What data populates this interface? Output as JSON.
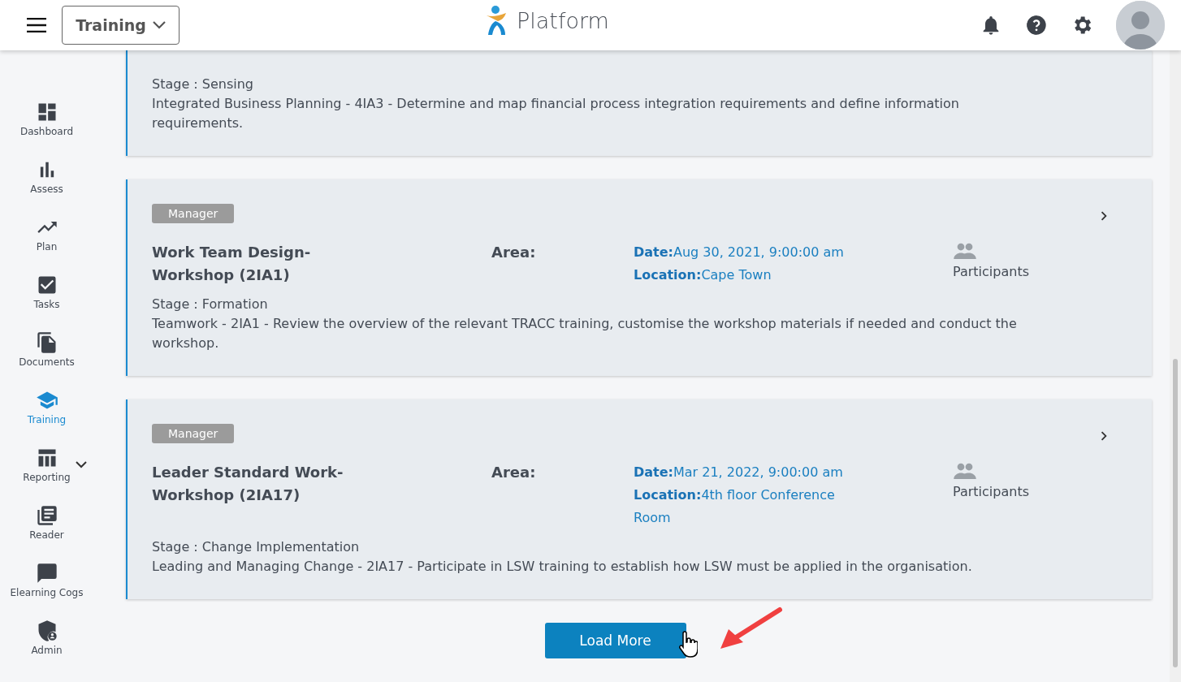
{
  "header": {
    "module_select": "Training",
    "app_name": "Platform"
  },
  "sidebar": {
    "items": [
      {
        "label": "Dashboard",
        "selected": false,
        "expandable": false
      },
      {
        "label": "Assess",
        "selected": false,
        "expandable": false
      },
      {
        "label": "Plan",
        "selected": false,
        "expandable": false
      },
      {
        "label": "Tasks",
        "selected": false,
        "expandable": false
      },
      {
        "label": "Documents",
        "selected": false,
        "expandable": false
      },
      {
        "label": "Training",
        "selected": true,
        "expandable": false
      },
      {
        "label": "Reporting",
        "selected": false,
        "expandable": true
      },
      {
        "label": "Reader",
        "selected": false,
        "expandable": false
      },
      {
        "label": "Elearning Cogs",
        "selected": false,
        "expandable": false
      },
      {
        "label": "Admin",
        "selected": false,
        "expandable": false
      }
    ]
  },
  "cards": [
    {
      "stage": "Stage : Sensing",
      "description": "Integrated Business Planning - 4IA3 - Determine and map financial process integration requirements and define information requirements."
    },
    {
      "badge": "Manager",
      "title": "Work Team Design-Workshop (2IA1)",
      "area_label": "Area:",
      "date_label": "Date:",
      "date": "Aug 30, 2021, 9:00:00 am",
      "location_label": "Location:",
      "location": "Cape Town",
      "participants": "Participants",
      "stage": "Stage : Formation",
      "description": "Teamwork - 2IA1 - Review the overview of the relevant TRACC training, customise the workshop materials if needed and conduct the workshop."
    },
    {
      "badge": "Manager",
      "title": "Leader Standard Work-Workshop (2IA17)",
      "area_label": "Area:",
      "date_label": "Date:",
      "date": "Mar 21, 2022, 9:00:00 am",
      "location_label": "Location:",
      "location": "4th floor Conference Room",
      "participants": "Participants",
      "stage": "Stage : Change Implementation",
      "description": "Leading and Managing Change - 2IA17 - Participate in LSW training to establish how LSW must be applied in the organisation."
    }
  ],
  "load_more": "Load More"
}
